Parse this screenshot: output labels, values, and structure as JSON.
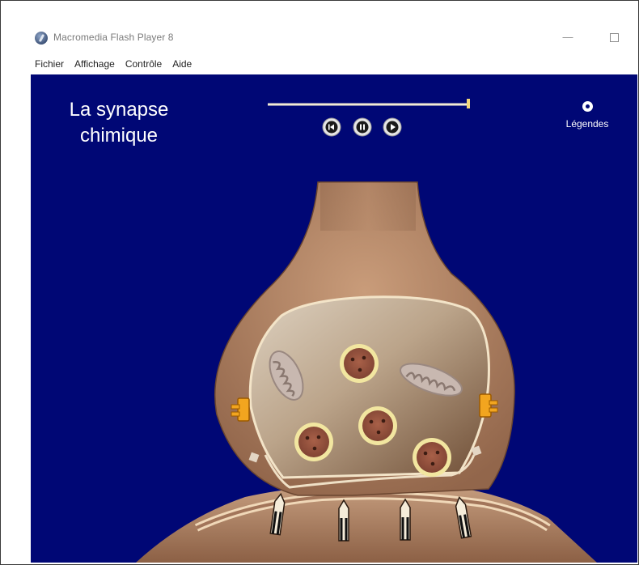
{
  "window": {
    "title": "Macromedia Flash Player 8",
    "minimize_glyph": "—"
  },
  "menu": [
    "Fichier",
    "Affichage",
    "Contrôle",
    "Aide"
  ],
  "stage": {
    "title_line1": "La synapse",
    "title_line2": "chimique",
    "legend_label": "Légendes",
    "progress": 1.0
  },
  "colors": {
    "stage_background": "#000775",
    "neuron": "#a87a5c",
    "vesicle_ring": "#f2e6a0",
    "vesicle_fill": "#8c4a36",
    "channel": "#f2a51f"
  },
  "icons": {
    "app": "flash-player-icon",
    "rewind": "rewind-icon",
    "pause": "pause-icon",
    "play": "play-icon",
    "legend": "radio-dot-icon"
  }
}
